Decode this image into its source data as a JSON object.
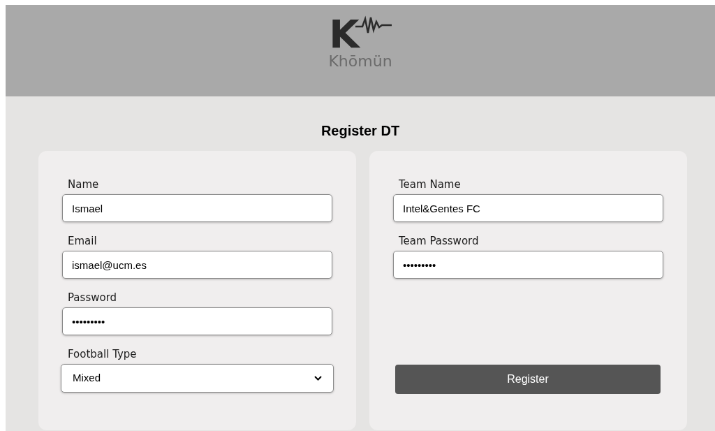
{
  "header": {
    "logo_letter": "K",
    "logo_name": "Khōmün"
  },
  "title": "Register DT",
  "left_fields": [
    {
      "kind": "text",
      "label": "Name",
      "value": "Ismael"
    },
    {
      "kind": "text",
      "label": "Email",
      "value": "ismael@ucm.es"
    },
    {
      "kind": "text",
      "label": "Password",
      "value": "•••••••••"
    },
    {
      "kind": "select",
      "label": "Football Type",
      "value": "Mixed"
    }
  ],
  "right_fields": [
    {
      "kind": "text",
      "label": "Team Name",
      "value": "Intel&Gentes FC"
    },
    {
      "kind": "text",
      "label": "Team Password",
      "value": "•••••••••"
    }
  ],
  "button": "Register"
}
